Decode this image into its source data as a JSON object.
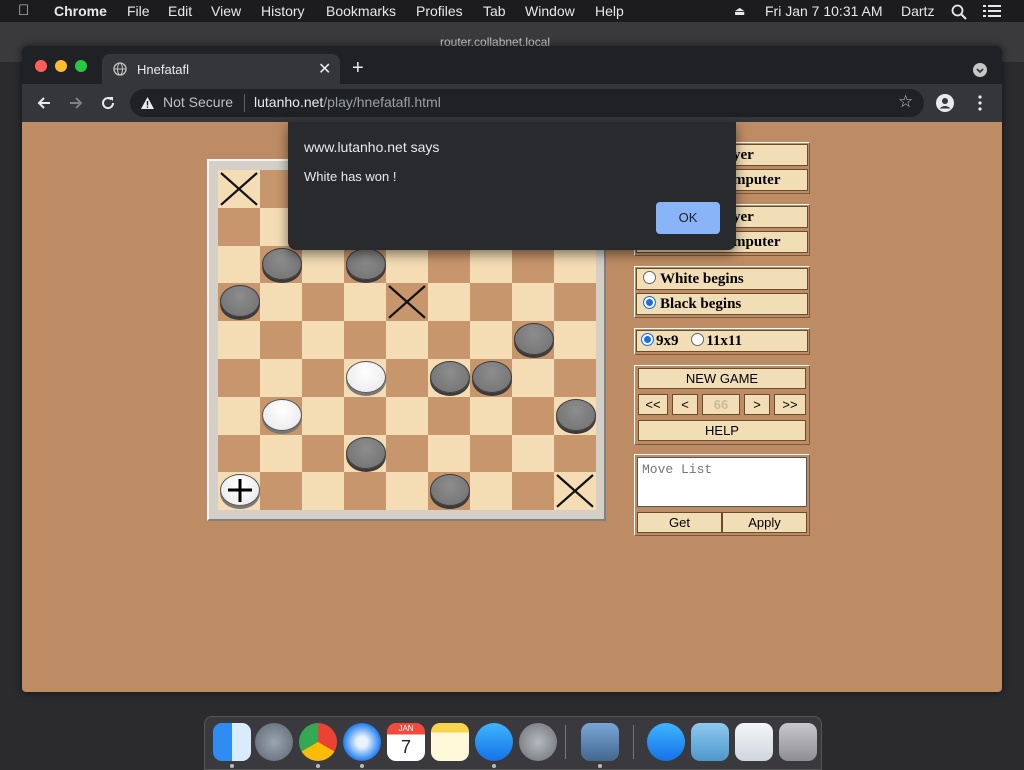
{
  "menubar": {
    "app": "Chrome",
    "items": [
      "File",
      "Edit",
      "View",
      "History",
      "Bookmarks",
      "Profiles",
      "Tab",
      "Window",
      "Help"
    ],
    "clock": "Fri Jan 7  10:31 AM",
    "user": "Dartz"
  },
  "background_window": {
    "title": "router.collabnet.local"
  },
  "browser": {
    "tab_title": "Hnefatafl",
    "security": "Not Secure",
    "url_domain": "lutanho.net",
    "url_path": "/play/hnefatafl.html"
  },
  "dialog": {
    "title": "www.lutanho.net says",
    "message": "White has won !",
    "ok_label": "OK"
  },
  "panel": {
    "white_player_label": "yer",
    "white_computer_label": "mputer",
    "black_player_label": "yer",
    "black_computer_label": "mputer",
    "begins_options": [
      "White begins",
      "Black begins"
    ],
    "begins_selected": "Black begins",
    "size_options": [
      "9x9",
      "11x11"
    ],
    "size_selected": "9x9",
    "new_game_label": "NEW GAME",
    "nav": {
      "first": "<<",
      "prev": "<",
      "move_number": "66",
      "next": ">",
      "last": ">>"
    },
    "help_label": "HELP",
    "move_list_placeholder": "Move List",
    "get_label": "Get",
    "apply_label": "Apply"
  },
  "board": {
    "size": 9,
    "colors": {
      "light": "#f4dcb4",
      "dark": "#c8966c"
    },
    "x_marks": [
      [
        0,
        0
      ],
      [
        3,
        4
      ],
      [
        8,
        8
      ]
    ],
    "pieces": [
      {
        "row": 2,
        "col": 1,
        "color": "black"
      },
      {
        "row": 2,
        "col": 3,
        "color": "black"
      },
      {
        "row": 3,
        "col": 0,
        "color": "black"
      },
      {
        "row": 4,
        "col": 7,
        "color": "black"
      },
      {
        "row": 5,
        "col": 3,
        "color": "white"
      },
      {
        "row": 5,
        "col": 5,
        "color": "black"
      },
      {
        "row": 5,
        "col": 6,
        "color": "black"
      },
      {
        "row": 6,
        "col": 1,
        "color": "white"
      },
      {
        "row": 6,
        "col": 8,
        "color": "black"
      },
      {
        "row": 7,
        "col": 3,
        "color": "black"
      },
      {
        "row": 8,
        "col": 0,
        "color": "king"
      },
      {
        "row": 8,
        "col": 5,
        "color": "black"
      }
    ]
  },
  "dock": {
    "apps": [
      "finder-icon",
      "launchpad-icon",
      "chrome-icon",
      "safari-icon",
      "calendar-icon",
      "notes-icon",
      "app-store-icon",
      "system-preferences-icon",
      "preview-icon",
      "app-store-2-icon",
      "downloads-folder-icon",
      "mail-icon",
      "trash-icon"
    ],
    "calendar_month": "JAN",
    "calendar_day": "7"
  }
}
